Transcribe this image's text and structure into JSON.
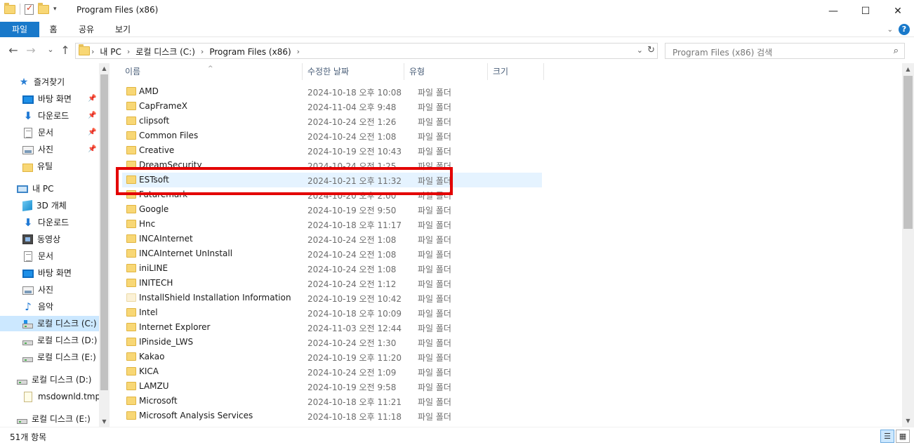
{
  "window": {
    "title": "Program Files (x86)",
    "minimize_glyph": "—",
    "maximize_glyph": "☐",
    "close_glyph": "✕"
  },
  "ribbon": {
    "tabs": [
      "파일",
      "홈",
      "공유",
      "보기"
    ],
    "help_label": "?",
    "expand_glyph": "⌄",
    "accent_color": "#1979ca"
  },
  "nav": {
    "back_glyph": "←",
    "forward_glyph": "→",
    "recent_glyph": "⌄",
    "up_glyph": "↑"
  },
  "address": {
    "crumbs": [
      "내 PC",
      "로컬 디스크 (C:)",
      "Program Files (x86)"
    ],
    "separator": "›",
    "dropdown_glyph": "⌄",
    "refresh_glyph": "↻"
  },
  "search": {
    "placeholder": "Program Files (x86) 검색",
    "icon": "search-icon",
    "icon_glyph": "⌕"
  },
  "sidebar": {
    "items": [
      {
        "label": "즐겨찾기",
        "icon": "star-icon",
        "indent": 0
      },
      {
        "label": "바탕 화면",
        "icon": "desktop-icon",
        "indent": 1,
        "pinned": true
      },
      {
        "label": "다운로드",
        "icon": "download-icon",
        "indent": 1,
        "pinned": true
      },
      {
        "label": "문서",
        "icon": "document-icon",
        "indent": 1,
        "pinned": true
      },
      {
        "label": "사진",
        "icon": "picture-icon",
        "indent": 1,
        "pinned": true
      },
      {
        "label": "유틸",
        "icon": "folder-icon",
        "indent": 1
      },
      {
        "label": "내 PC",
        "icon": "pc-icon",
        "indent": 0
      },
      {
        "label": "3D 개체",
        "icon": "3d-objects-icon",
        "indent": 1
      },
      {
        "label": "다운로드",
        "icon": "download-icon",
        "indent": 1
      },
      {
        "label": "동영상",
        "icon": "video-icon",
        "indent": 1
      },
      {
        "label": "문서",
        "icon": "document-icon",
        "indent": 1
      },
      {
        "label": "바탕 화면",
        "icon": "desktop-icon",
        "indent": 1
      },
      {
        "label": "사진",
        "icon": "picture-icon",
        "indent": 1
      },
      {
        "label": "음악",
        "icon": "music-icon",
        "indent": 1
      },
      {
        "label": "로컬 디스크 (C:)",
        "icon": "system-drive-icon",
        "indent": 1,
        "selected": true
      },
      {
        "label": "로컬 디스크 (D:)",
        "icon": "drive-icon",
        "indent": 1
      },
      {
        "label": "로컬 디스크 (E:)",
        "icon": "drive-icon",
        "indent": 1
      },
      {
        "label": "로컬 디스크 (D:)",
        "icon": "drive-icon",
        "indent": 0
      },
      {
        "label": "msdownld.tmp",
        "icon": "file-icon",
        "indent": 1
      },
      {
        "label": "로컬 디스크 (E:)",
        "icon": "drive-icon",
        "indent": 0
      }
    ],
    "pin_glyph": "📌",
    "selected_bg": "#cce8ff"
  },
  "columns": {
    "name": "이름",
    "modified": "수정한 날짜",
    "type": "유형",
    "size": "크기",
    "sort_glyph": "^"
  },
  "files": [
    {
      "name": "AMD",
      "modified": "2024-10-18 오후 10:08",
      "type": "파일 폴더"
    },
    {
      "name": "CapFrameX",
      "modified": "2024-11-04 오후 9:48",
      "type": "파일 폴더"
    },
    {
      "name": "clipsoft",
      "modified": "2024-10-24 오전 1:26",
      "type": "파일 폴더"
    },
    {
      "name": "Common Files",
      "modified": "2024-10-24 오전 1:08",
      "type": "파일 폴더"
    },
    {
      "name": "Creative",
      "modified": "2024-10-19 오전 10:43",
      "type": "파일 폴더"
    },
    {
      "name": "DreamSecurity",
      "modified": "2024-10-24 오전 1:25",
      "type": "파일 폴더"
    },
    {
      "name": "ESTsoft",
      "modified": "2024-10-21 오후 11:32",
      "type": "파일 폴더",
      "highlighted": true
    },
    {
      "name": "Futuremark",
      "modified": "2024-10-20 오후 2:00",
      "type": "파일 폴더"
    },
    {
      "name": "Google",
      "modified": "2024-10-19 오전 9:50",
      "type": "파일 폴더"
    },
    {
      "name": "Hnc",
      "modified": "2024-10-18 오후 11:17",
      "type": "파일 폴더"
    },
    {
      "name": "INCAInternet",
      "modified": "2024-10-24 오전 1:08",
      "type": "파일 폴더"
    },
    {
      "name": "INCAInternet UnInstall",
      "modified": "2024-10-24 오전 1:08",
      "type": "파일 폴더"
    },
    {
      "name": "iniLINE",
      "modified": "2024-10-24 오전 1:08",
      "type": "파일 폴더"
    },
    {
      "name": "INITECH",
      "modified": "2024-10-24 오전 1:12",
      "type": "파일 폴더"
    },
    {
      "name": "InstallShield Installation Information",
      "modified": "2024-10-19 오전 10:42",
      "type": "파일 폴더",
      "hidden_style": true
    },
    {
      "name": "Intel",
      "modified": "2024-10-18 오후 10:09",
      "type": "파일 폴더"
    },
    {
      "name": "Internet Explorer",
      "modified": "2024-11-03 오전 12:44",
      "type": "파일 폴더"
    },
    {
      "name": "IPinside_LWS",
      "modified": "2024-10-24 오전 1:30",
      "type": "파일 폴더"
    },
    {
      "name": "Kakao",
      "modified": "2024-10-19 오후 11:20",
      "type": "파일 폴더"
    },
    {
      "name": "KICA",
      "modified": "2024-10-24 오전 1:09",
      "type": "파일 폴더"
    },
    {
      "name": "LAMZU",
      "modified": "2024-10-19 오전 9:58",
      "type": "파일 폴더"
    },
    {
      "name": "Microsoft",
      "modified": "2024-10-18 오후 11:21",
      "type": "파일 폴더"
    },
    {
      "name": "Microsoft Analysis Services",
      "modified": "2024-10-18 오후 11:18",
      "type": "파일 폴더"
    }
  ],
  "status": {
    "item_count": "51개 항목",
    "details_view_glyph": "☰",
    "tiles_view_glyph": "▦"
  },
  "colors": {
    "highlight_row": "#e5f3ff",
    "annotation_box": "#e30000"
  }
}
